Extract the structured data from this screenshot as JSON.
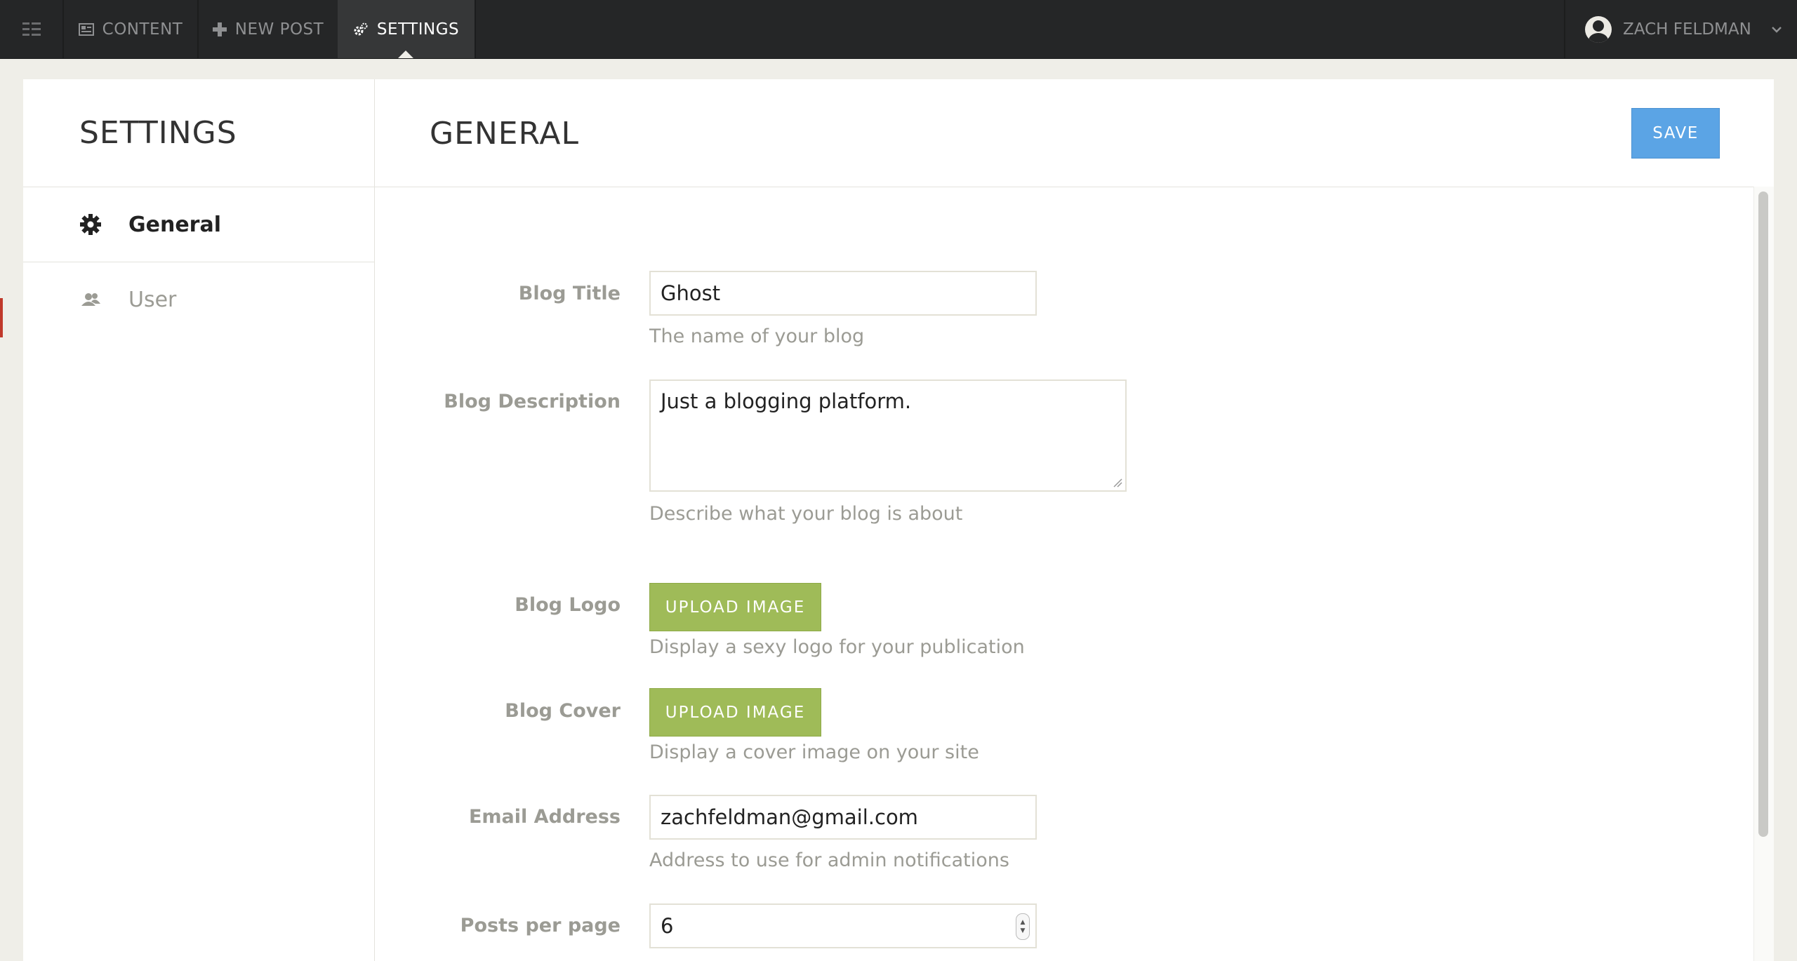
{
  "nav": {
    "content_label": "Content",
    "new_post_label": "New Post",
    "settings_label": "Settings",
    "user_name": "Zach Feldman"
  },
  "sidebar": {
    "title": "SETTINGS",
    "items": [
      {
        "label": "General",
        "icon": "gear-icon",
        "active": true
      },
      {
        "label": "User",
        "icon": "user-icon",
        "active": false
      }
    ]
  },
  "content": {
    "title": "GENERAL",
    "save_label": "Save"
  },
  "form": {
    "blog_title": {
      "label": "Blog Title",
      "value": "Ghost",
      "help": "The name of your blog"
    },
    "blog_description": {
      "label": "Blog Description",
      "value": "Just a blogging platform.",
      "help": "Describe what your blog is about"
    },
    "blog_logo": {
      "label": "Blog Logo",
      "button": "Upload Image",
      "help": "Display a sexy logo for your publication"
    },
    "blog_cover": {
      "label": "Blog Cover",
      "button": "Upload Image",
      "help": "Display a cover image on your site"
    },
    "email": {
      "label": "Email Address",
      "value": "zachfeldman@gmail.com",
      "help": "Address to use for admin notifications"
    },
    "posts_per_page": {
      "label": "Posts per page",
      "value": "6"
    }
  },
  "colors": {
    "topbar": "#252627",
    "save_button": "#5ba4e5",
    "upload_button": "#9fbb58",
    "label": "#9b9b94"
  }
}
